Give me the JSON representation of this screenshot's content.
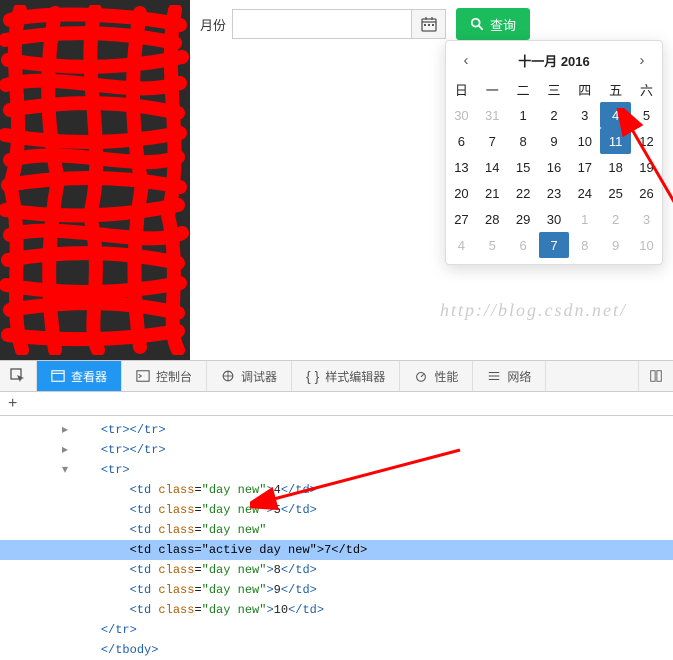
{
  "toolbar": {
    "month_label": "月份",
    "query_label": "查询"
  },
  "datepicker": {
    "title": "十一月 2016",
    "weekdays": [
      "日",
      "一",
      "二",
      "三",
      "四",
      "五",
      "六"
    ],
    "rows": [
      [
        {
          "d": "30",
          "m": true
        },
        {
          "d": "31",
          "m": true
        },
        {
          "d": "1"
        },
        {
          "d": "2"
        },
        {
          "d": "3"
        },
        {
          "d": "4",
          "s": true
        },
        {
          "d": "5"
        }
      ],
      [
        {
          "d": "6"
        },
        {
          "d": "7"
        },
        {
          "d": "8"
        },
        {
          "d": "9"
        },
        {
          "d": "10"
        },
        {
          "d": "11",
          "s": true
        },
        {
          "d": "12"
        }
      ],
      [
        {
          "d": "13"
        },
        {
          "d": "14"
        },
        {
          "d": "15"
        },
        {
          "d": "16"
        },
        {
          "d": "17"
        },
        {
          "d": "18"
        },
        {
          "d": "19"
        }
      ],
      [
        {
          "d": "20"
        },
        {
          "d": "21"
        },
        {
          "d": "22"
        },
        {
          "d": "23"
        },
        {
          "d": "24"
        },
        {
          "d": "25"
        },
        {
          "d": "26"
        }
      ],
      [
        {
          "d": "27"
        },
        {
          "d": "28"
        },
        {
          "d": "29"
        },
        {
          "d": "30"
        },
        {
          "d": "1",
          "m": true
        },
        {
          "d": "2",
          "m": true
        },
        {
          "d": "3",
          "m": true
        }
      ],
      [
        {
          "d": "4",
          "m": true
        },
        {
          "d": "5",
          "m": true
        },
        {
          "d": "6",
          "m": true
        },
        {
          "d": "7",
          "m": true,
          "s": true
        },
        {
          "d": "8",
          "m": true
        },
        {
          "d": "9",
          "m": true
        },
        {
          "d": "10",
          "m": true
        }
      ]
    ]
  },
  "watermark": "http://blog.csdn.net/",
  "devtools": {
    "tabs": {
      "inspect": "查看器",
      "console": "控制台",
      "debugger": "调试器",
      "style": "样式编辑器",
      "perf": "性能",
      "network": "网络"
    },
    "code": [
      {
        "indent": 1,
        "caret": "▸",
        "html": "<tr></tr>"
      },
      {
        "indent": 1,
        "caret": "▸",
        "html": "<tr></tr>"
      },
      {
        "indent": 1,
        "caret": "▾",
        "html": "<tr>"
      },
      {
        "indent": 2,
        "td": {
          "cls": "day new",
          "txt": "4"
        }
      },
      {
        "indent": 2,
        "td": {
          "cls": "day new",
          "txt": "5"
        }
      },
      {
        "indent": 2,
        "td_cut": {
          "cls": "day new"
        }
      },
      {
        "indent": 2,
        "hl": true,
        "td": {
          "cls": "active day new",
          "txt": "7"
        }
      },
      {
        "indent": 2,
        "td": {
          "cls": "day new",
          "txt": "8"
        }
      },
      {
        "indent": 2,
        "td": {
          "cls": "day new",
          "txt": "9"
        }
      },
      {
        "indent": 2,
        "td": {
          "cls": "day new",
          "txt": "10"
        }
      },
      {
        "indent": 1,
        "html": "</tr>"
      },
      {
        "indent": 1,
        "close_tbody": true
      }
    ]
  }
}
